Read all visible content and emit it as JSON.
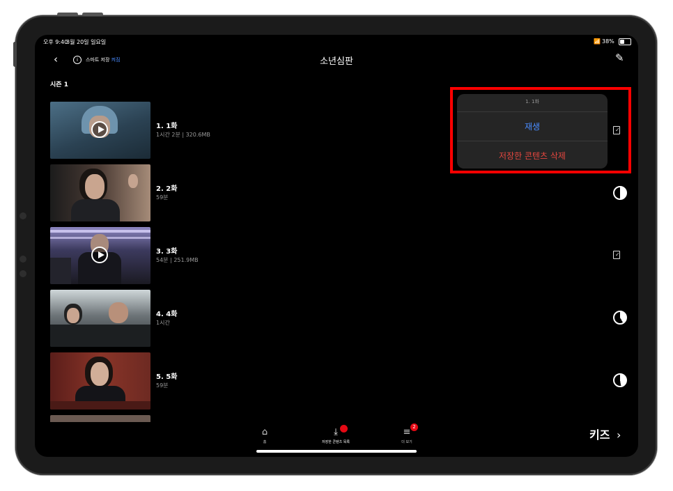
{
  "status_bar": {
    "time": "오후 9:40",
    "date": "3월 20일 일요일",
    "battery": "38%"
  },
  "header": {
    "smart_save_label": "스마트 저장",
    "smart_save_state": "켜짐",
    "title": "소년심판"
  },
  "season": "시즌 1",
  "episodes": [
    {
      "title": "1. 1화",
      "meta": "1시간 2분 | 320.6MB",
      "status": "check-icon",
      "playable": true
    },
    {
      "title": "2. 2화",
      "meta": "59분",
      "status": "partial-download-icon",
      "playable": false
    },
    {
      "title": "3. 3화",
      "meta": "54분 | 251.9MB",
      "status": "check-icon",
      "playable": true
    },
    {
      "title": "4. 4화",
      "meta": "1시간",
      "status": "partial-download-icon",
      "playable": false
    },
    {
      "title": "5. 5화",
      "meta": "59분",
      "status": "partial-download-icon",
      "playable": false
    }
  ],
  "popup": {
    "header": "1. 1화",
    "play": "재생",
    "delete": "저장한 콘텐츠 삭제"
  },
  "tabbar": {
    "home": "홈",
    "downloads": "저장한 콘텐츠 목록",
    "more": "더 보기",
    "more_badge": "2"
  },
  "kids": "키즈",
  "colors": {
    "accent_blue": "#4a8cff",
    "delete_red": "#e5473f",
    "badge_red": "#e50914",
    "highlight": "#ff0000"
  }
}
